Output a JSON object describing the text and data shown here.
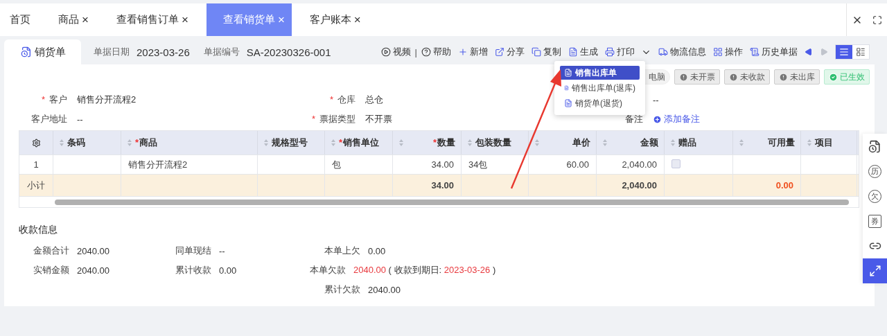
{
  "tabs": [
    {
      "label": "首页",
      "closable": false,
      "selected": false
    },
    {
      "label": "商品",
      "closable": true,
      "selected": false
    },
    {
      "label": "查看销售订单",
      "closable": true,
      "selected": false
    },
    {
      "label": "查看销货单",
      "closable": true,
      "selected": true
    },
    {
      "label": "客户账本",
      "closable": true,
      "selected": false
    }
  ],
  "close_symbol": "×",
  "required_mark": "*",
  "document": {
    "tab_label": "销货单",
    "date_label": "单据日期",
    "date": "2023-03-26",
    "number_label": "单据编号",
    "number": "SA-20230326-001"
  },
  "toolbar": [
    {
      "kind": "video",
      "label": "视频"
    },
    {
      "kind": "divider",
      "label": "|"
    },
    {
      "kind": "help",
      "label": "帮助"
    },
    {
      "kind": "add",
      "label": "新增"
    },
    {
      "kind": "share",
      "label": "分享"
    },
    {
      "kind": "copy",
      "label": "复制"
    },
    {
      "kind": "generate",
      "label": "生成"
    },
    {
      "kind": "print",
      "label": "打印"
    },
    {
      "kind": "logistics",
      "label": "物流信息"
    },
    {
      "kind": "operate",
      "label": "操作"
    },
    {
      "kind": "history",
      "label": "历史单据"
    }
  ],
  "pager": [
    {
      "kind": "prev",
      "disabled": false
    },
    {
      "kind": "next",
      "disabled": true
    }
  ],
  "view_toggle": [
    {
      "kind": "list",
      "selected": true
    },
    {
      "kind": "detail",
      "selected": false
    }
  ],
  "dropdown": [
    {
      "label": "销售出库单",
      "selected": true
    },
    {
      "label": "销售出库单(退库)",
      "selected": false
    },
    {
      "label": "销货单(退货)",
      "selected": false
    }
  ],
  "badges": [
    {
      "kind": "plain",
      "label": "电脑"
    },
    {
      "kind": "warn",
      "label": "未开票"
    },
    {
      "kind": "warn",
      "label": "未收款"
    },
    {
      "kind": "warn",
      "label": "未出库"
    },
    {
      "kind": "ok",
      "label": "已生效"
    }
  ],
  "form": [
    [
      {
        "label": "客户",
        "required": true,
        "value": "销售分开流程2"
      },
      {
        "label": "仓库",
        "required": true,
        "value": "总仓"
      },
      {
        "value": "--"
      }
    ],
    [
      {
        "label": "客户地址",
        "required": false,
        "value": "--"
      },
      {
        "label": "票据类型",
        "required": true,
        "value": "不开票"
      },
      {
        "label": "备注",
        "required": false,
        "link": "添加备注"
      }
    ]
  ],
  "table": {
    "columns": [
      {
        "kind": "settings"
      },
      {
        "kind": "text",
        "label": "条码",
        "required": false
      },
      {
        "kind": "text",
        "label": "商品",
        "required": true
      },
      {
        "kind": "text",
        "label": "规格型号",
        "required": false
      },
      {
        "kind": "text",
        "label": "销售单位",
        "required": true
      },
      {
        "kind": "number",
        "label": "数量",
        "required": true
      },
      {
        "kind": "text",
        "label": "包装数量",
        "required": false
      },
      {
        "kind": "number",
        "label": "单价",
        "required": false
      },
      {
        "kind": "number",
        "label": "金额",
        "required": false
      },
      {
        "kind": "text",
        "label": "赠品",
        "required": false
      },
      {
        "kind": "number",
        "label": "可用量",
        "required": false
      },
      {
        "kind": "text",
        "label": "项目",
        "required": false
      }
    ],
    "rows": [
      {
        "cells": [
          {
            "kind": "text",
            "text": "1"
          },
          {
            "kind": "blank"
          },
          {
            "kind": "text",
            "text": "销售分开流程2"
          },
          {
            "kind": "blank"
          },
          {
            "kind": "text",
            "text": "包"
          },
          {
            "kind": "text",
            "text": "34.00"
          },
          {
            "kind": "text",
            "text": "34包"
          },
          {
            "kind": "text",
            "text": "60.00"
          },
          {
            "kind": "text",
            "text": "2,040.00"
          },
          {
            "kind": "checkbox",
            "checked": false
          },
          {
            "kind": "blank"
          },
          {
            "kind": "blank"
          }
        ]
      }
    ],
    "subtotal": [
      {
        "kind": "label",
        "text": "小计"
      },
      {
        "kind": "blank"
      },
      {
        "kind": "blank"
      },
      {
        "kind": "blank"
      },
      {
        "kind": "blank"
      },
      {
        "kind": "value",
        "text": "34.00",
        "alert": false
      },
      {
        "kind": "blank"
      },
      {
        "kind": "blank"
      },
      {
        "kind": "value",
        "text": "2,040.00",
        "alert": false
      },
      {
        "kind": "blank"
      },
      {
        "kind": "value",
        "text": "0.00",
        "alert": true
      },
      {
        "kind": "blank"
      }
    ]
  },
  "payment": {
    "title": "收款信息",
    "columns": [
      [
        {
          "label": "金额合计",
          "value": [
            {
              "text": "2040.00",
              "alert": false
            }
          ]
        },
        {
          "label": "实销金额",
          "value": [
            {
              "text": "2040.00",
              "alert": false
            }
          ]
        }
      ],
      [
        {
          "label": "同单现结",
          "value": [
            {
              "text": "--",
              "alert": false
            }
          ]
        },
        {
          "label": "累计收款",
          "value": [
            {
              "text": "0.00",
              "alert": false
            }
          ]
        }
      ],
      [
        {
          "label": "本单上欠",
          "value": [
            {
              "text": "0.00",
              "alert": false
            }
          ]
        },
        {
          "label": "本单欠款",
          "value": [
            {
              "text": "2040.00",
              "alert": true
            },
            {
              "text": " ( 收款到期日: ",
              "alert": false
            },
            {
              "text": "2023-03-26",
              "alert": true
            },
            {
              "text": " )",
              "alert": false
            }
          ]
        },
        {
          "label": "累计欠款",
          "value": [
            {
              "text": "2040.00",
              "alert": false
            }
          ]
        }
      ]
    ]
  },
  "side_tools": [
    {
      "kind": "note",
      "selected": false
    },
    {
      "kind": "glyph",
      "glyph": "历",
      "selected": false
    },
    {
      "kind": "glyph",
      "glyph": "欠",
      "selected": false
    },
    {
      "kind": "boxed",
      "glyph": "券",
      "selected": false
    },
    {
      "kind": "link",
      "selected": false
    },
    {
      "kind": "expand",
      "selected": true
    }
  ]
}
